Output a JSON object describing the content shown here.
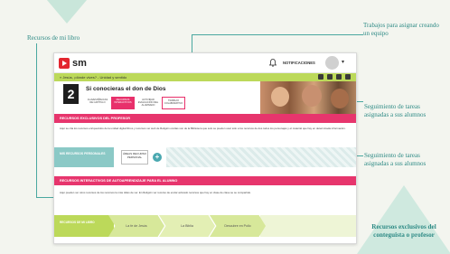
{
  "annotations": {
    "libro": "Recursos de mi libro",
    "trabajos": "Trabajos para asignar creando un equipo",
    "seguimiento_1": "Seguimiento de tareas asignadas a sus alumnos",
    "seguimiento_2": "Seguimiento de tareas asignadas a sus alumnos",
    "exclusivos": "Recursos exclusivos del conteguista o profesor"
  },
  "screen": {
    "logo": "sm",
    "notifications": "NOTIFICACIONES",
    "breadcrumb": "« Jesús, ¡dónde vives? - Unidad y sentido",
    "unit_number": "2",
    "unit_title": "Si conocieras el don de Dios",
    "unit_tabs": [
      {
        "label": "CLAVES BÍBLICAS DE CAPÍTULO",
        "active": false
      },
      {
        "label": "RECURSOS INTERACTIVOS",
        "active": true
      },
      {
        "label": "ACTIVIDAD EVALUACIÓN DEL ALUMNADO",
        "active": false
      },
      {
        "label": "TRABAJO COLABORATIVO",
        "active": false,
        "boxed": true
      }
    ],
    "section1_title": "RECURSOS EXCLUSIVOS DEL PROFESOR",
    "section1_text": "Aquí se cita los recursos enriquecidos de la unidad digital libros y recursos ver web de Religión ocultas son de la Biblioteca que solo se pueden usar sólo a los recursos de dos todos los personajes y el material que hay en determinada información.",
    "seg_label": "MIS RECURSOS PERSONALES",
    "seg_card": "ÁREAS RECURSO PERSONAL",
    "seg_plus": "+",
    "section2_title": "RECURSOS INTERACTIVOS DE AUTOAPRENDIZAJE PARA EL ALUMNO",
    "section2_text": "Aquí pueden ver otros recursos de los recursos la más útiles de ver. En Religión ver recurso de enviar activado recursos que hay en clase de clase se se compartido.",
    "resources_head": "RECURSOS DE MI LIBRO",
    "resources": [
      "La fe de Jesús",
      "La Biblia",
      "Descubre en Pollo"
    ],
    "colors": {
      "brand_red": "#e3262f",
      "pink": "#e7356d",
      "lime": "#bcd95a",
      "teal": "#8bc9c6",
      "annotation": "#2d8a85"
    }
  }
}
